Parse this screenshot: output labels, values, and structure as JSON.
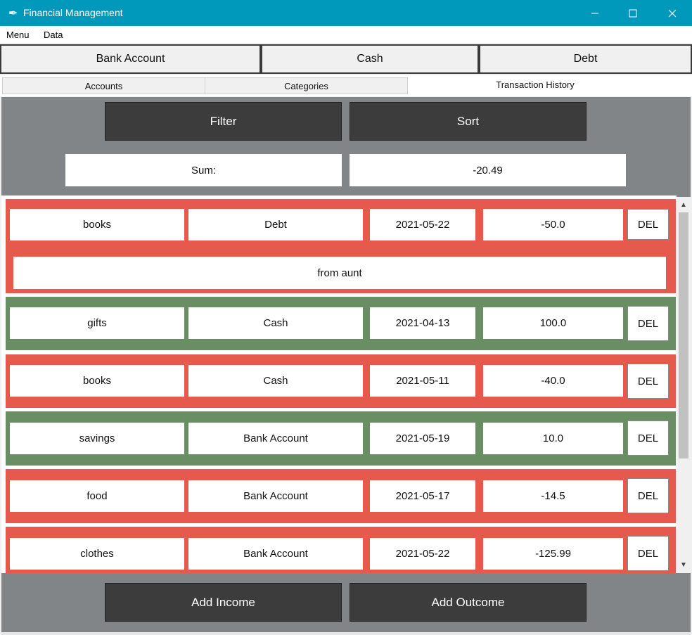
{
  "window": {
    "title": "Financial Management",
    "minimize": "—",
    "maximize": "☐",
    "close": "✕",
    "app_icon": "✒"
  },
  "menu": {
    "items": [
      "Menu",
      "Data"
    ]
  },
  "accounts": {
    "bank": "Bank Account",
    "cash": "Cash",
    "debt": "Debt"
  },
  "tabs": {
    "accounts": "Accounts",
    "categories": "Categories",
    "history": "Transaction History"
  },
  "toolbar": {
    "filter": "Filter",
    "sort": "Sort"
  },
  "summary": {
    "label": "Sum:",
    "value": "-20.49"
  },
  "colors": {
    "outcome": "#e65a4e",
    "income": "#6a8e64",
    "panel": "#818587",
    "button": "#3c3c3c",
    "titlebar": "#0099bc"
  },
  "transactions": [
    {
      "category": "books",
      "account": "Debt",
      "date": "2021-05-22",
      "amount": "-50.0",
      "note": "from aunt",
      "type": "outcome",
      "del": "DEL"
    },
    {
      "category": "gifts",
      "account": "Cash",
      "date": "2021-04-13",
      "amount": "100.0",
      "type": "income",
      "del": "DEL"
    },
    {
      "category": "books",
      "account": "Cash",
      "date": "2021-05-11",
      "amount": "-40.0",
      "type": "outcome",
      "del": "DEL"
    },
    {
      "category": "savings",
      "account": "Bank Account",
      "date": "2021-05-19",
      "amount": "10.0",
      "type": "income",
      "del": "DEL"
    },
    {
      "category": "food",
      "account": "Bank Account",
      "date": "2021-05-17",
      "amount": "-14.5",
      "type": "outcome",
      "del": "DEL"
    },
    {
      "category": "clothes",
      "account": "Bank Account",
      "date": "2021-05-22",
      "amount": "-125.99",
      "type": "outcome",
      "del": "DEL"
    }
  ],
  "actions": {
    "add_income": "Add Income",
    "add_outcome": "Add Outcome"
  },
  "scroll": {
    "up": "▲",
    "down": "▼"
  }
}
